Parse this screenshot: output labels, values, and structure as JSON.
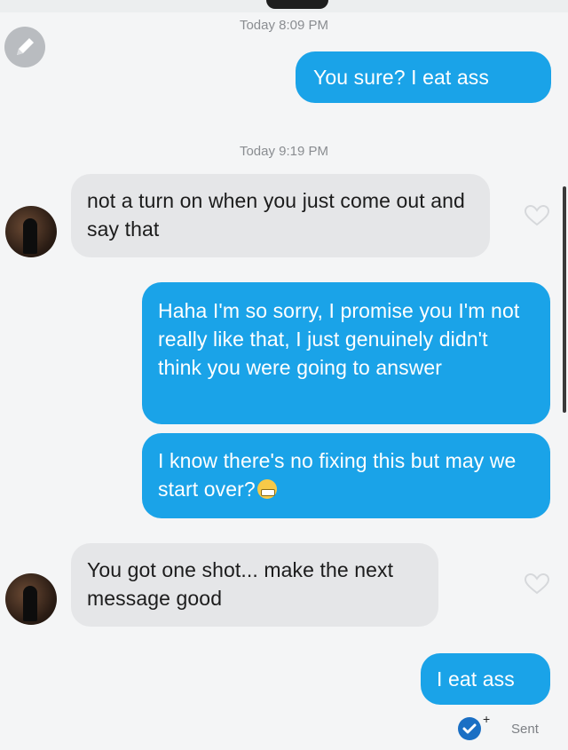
{
  "conversation": {
    "timestamps": [
      "Today 8:09 PM",
      "Today 9:19 PM"
    ],
    "messages": [
      {
        "from": "me",
        "text": "You sure? I eat ass"
      },
      {
        "from": "them",
        "text": "not a turn on when you just come out and say that"
      },
      {
        "from": "me",
        "text": "Haha I'm so sorry, I promise you I'm not really like that, I just genuinely didn't think you were going to answer"
      },
      {
        "from": "me",
        "text": "I know there's no fixing this but may we start over?"
      },
      {
        "from": "them",
        "text": "You got one shot... make the next message good"
      },
      {
        "from": "me",
        "text": "I eat ass"
      }
    ],
    "emoji": "grimacing-face",
    "status": "Sent"
  },
  "colors": {
    "outgoing": "#1aa3e8",
    "incoming": "#e5e6e8",
    "background": "#f4f5f6"
  }
}
